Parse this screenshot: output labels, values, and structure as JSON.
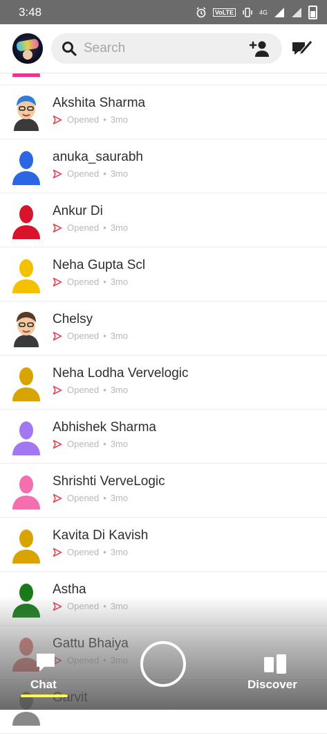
{
  "status_bar": {
    "time": "3:48",
    "volte": "VoLTE",
    "network": "4G"
  },
  "search": {
    "placeholder": "Search"
  },
  "chats": [
    {
      "name": "",
      "status": "Opened",
      "age": "3mo",
      "color": "#e8358f",
      "bitmoji": false
    },
    {
      "name": "Akshita Sharma",
      "status": "Opened",
      "age": "3mo",
      "color": "#2f7fd6",
      "bitmoji": true
    },
    {
      "name": "anuka_saurabh",
      "status": "Opened",
      "age": "3mo",
      "color": "#2b66e3",
      "bitmoji": false
    },
    {
      "name": "Ankur Di",
      "status": "Opened",
      "age": "3mo",
      "color": "#d8132c",
      "bitmoji": false
    },
    {
      "name": "Neha Gupta Scl",
      "status": "Opened",
      "age": "3mo",
      "color": "#f5c000",
      "bitmoji": false
    },
    {
      "name": "Chelsy",
      "status": "Opened",
      "age": "3mo",
      "color": "#5a3a2a",
      "bitmoji": true
    },
    {
      "name": "Neha Lodha Vervelogic",
      "status": "Opened",
      "age": "3mo",
      "color": "#d9a300",
      "bitmoji": false
    },
    {
      "name": "Abhishek Sharma",
      "status": "Opened",
      "age": "3mo",
      "color": "#a477f2",
      "bitmoji": false
    },
    {
      "name": "Shrishti VerveLogic",
      "status": "Opened",
      "age": "3mo",
      "color": "#f56fb0",
      "bitmoji": false
    },
    {
      "name": "Kavita Di Kavish",
      "status": "Opened",
      "age": "3mo",
      "color": "#d9a300",
      "bitmoji": false
    },
    {
      "name": "Astha",
      "status": "Opened",
      "age": "3mo",
      "color": "#1a7a1a",
      "bitmoji": false
    },
    {
      "name": "Gattu Bhaiya",
      "status": "Opened",
      "age": "3mo",
      "color": "#d8706a",
      "bitmoji": false
    },
    {
      "name": "Garvit",
      "status": "",
      "age": "",
      "color": "#888888",
      "bitmoji": false
    }
  ],
  "nav": {
    "chat_label": "Chat",
    "discover_label": "Discover"
  },
  "colors": {
    "accent_underline": "#fff94d",
    "sent_arrow": "#e0485a"
  },
  "watermark": "wsxdn.com"
}
